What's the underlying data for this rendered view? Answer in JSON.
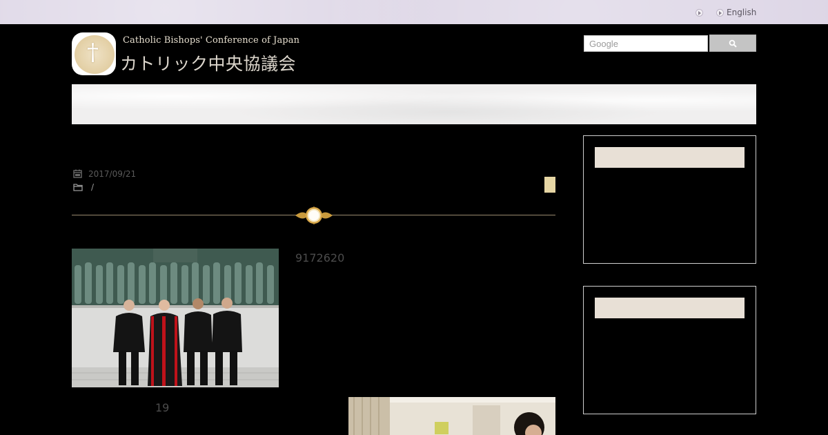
{
  "topbar": {
    "language_link": "English"
  },
  "header": {
    "logo_en": "Catholic Bishops' Conference of Japan",
    "logo_ja": "カトリック中央協議会",
    "logo_symbol": "†",
    "logo_icon": "cross-icon"
  },
  "search": {
    "placeholder": "Google",
    "button_icon": "search-icon"
  },
  "post": {
    "date": "2017/09/21",
    "category_separator": "/",
    "number": "9172620",
    "caption": "19",
    "date_icon": "calendar-icon",
    "category_icon": "folder-icon"
  },
  "sidebar": {
    "widgets": [
      {
        "title": ""
      },
      {
        "title": ""
      }
    ]
  },
  "colors": {
    "page_background": "#000000",
    "topbar_background": "#ddd6e6",
    "navbar_background": "#f0efef",
    "accent_gold": "#e6d6a4",
    "widget_title_background": "#e8e0d6"
  }
}
